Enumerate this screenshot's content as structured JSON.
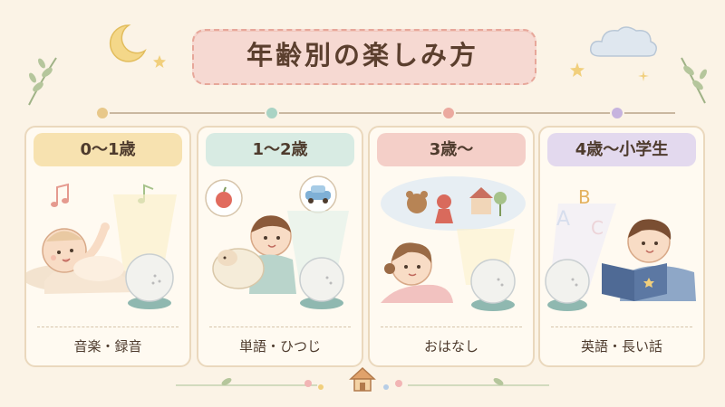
{
  "title": "年齢別の楽しみ方",
  "colors": {
    "background": "#fbf3e6",
    "title_plate": "#f6d9d2",
    "stage1": "#f7e2b0",
    "stage2": "#d8ebe3",
    "stage3": "#f4cfc8",
    "stage4": "#e3d9ee"
  },
  "stages": [
    {
      "age": "0～1歳",
      "activity": "音楽・録音",
      "icon": "music-notes-icon"
    },
    {
      "age": "1～2歳",
      "activity": "単語・ひつじ",
      "icon": "apple-car-bubbles-icon"
    },
    {
      "age": "3歳～",
      "activity": "おはなし",
      "icon": "story-projection-icon"
    },
    {
      "age": "4歳～小学生",
      "activity": "英語・長い話",
      "icon": "abc-letters-icon"
    }
  ]
}
